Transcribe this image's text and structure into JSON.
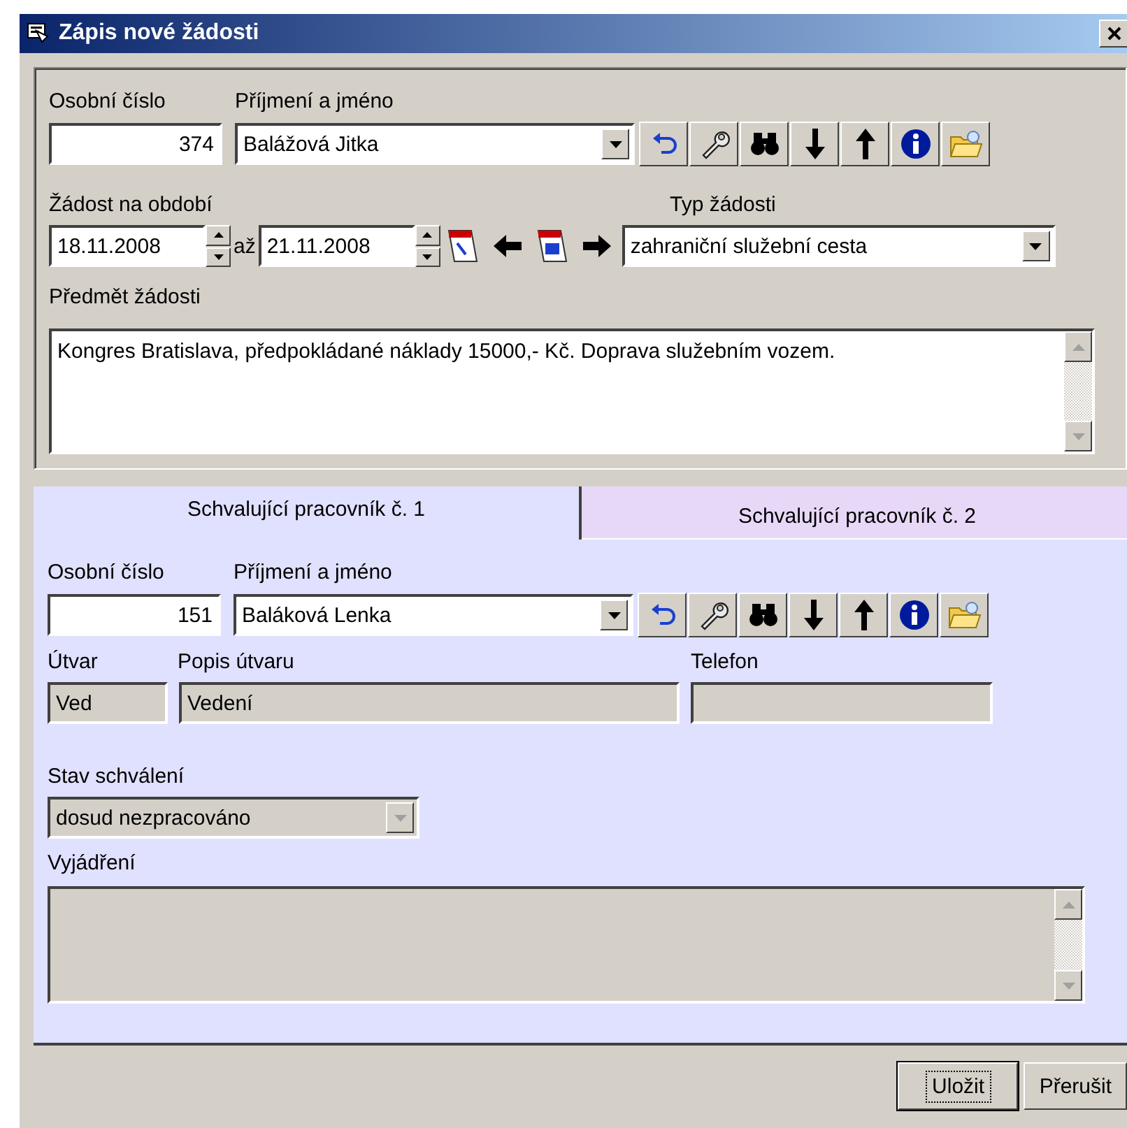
{
  "window": {
    "title": "Zápis nové žádosti"
  },
  "requester": {
    "number_label": "Osobní číslo",
    "number": "374",
    "name_label": "Příjmení a jméno",
    "name": "Balážová Jitka"
  },
  "period": {
    "label": "Žádost na období",
    "from": "18.11.2008",
    "separator": "až",
    "to": "21.11.2008"
  },
  "request_type": {
    "label": "Typ žádosti",
    "value": "zahraniční služební cesta"
  },
  "subject": {
    "label": "Předmět žádosti",
    "value": "Kongres Bratislava, předpokládané náklady 15000,- Kč. Doprava služebním vozem.",
    "disabled": false
  },
  "tabs": [
    {
      "label": "Schvalující pracovník č. 1",
      "selected": true
    },
    {
      "label": "Schvalující pracovník č. 2",
      "selected": false
    }
  ],
  "approver": {
    "number_label": "Osobní číslo",
    "number": "151",
    "name_label": "Příjmení a jméno",
    "name": "Baláková Lenka",
    "dept_label": "Útvar",
    "dept": "Ved",
    "dept_desc_label": "Popis útvaru",
    "dept_desc": "Vedení",
    "phone_label": "Telefon"
  },
  "status": {
    "label": "Stav schválení",
    "value": "dosud nezpracováno",
    "disabled": true
  },
  "comment": {
    "label": "Vyjádření",
    "disabled": true
  },
  "buttons": [
    {
      "label": "Uložit",
      "default": true
    },
    {
      "label": "Přerušit",
      "default": false
    }
  ]
}
